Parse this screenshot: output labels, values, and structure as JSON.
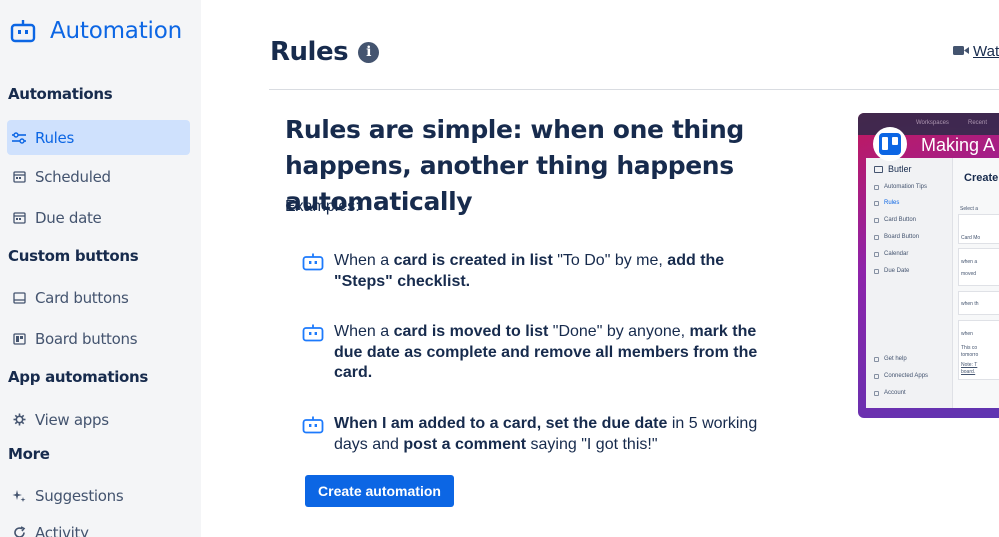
{
  "app": {
    "title": "Automation",
    "accent": "#0c66e4"
  },
  "sidebar": {
    "sections": [
      {
        "heading": "Automations"
      },
      {
        "heading": "Custom buttons"
      },
      {
        "heading": "App automations"
      },
      {
        "heading": "More"
      }
    ],
    "items": [
      {
        "label": "Rules",
        "icon": "rules-icon",
        "active": true
      },
      {
        "label": "Scheduled",
        "icon": "calendar-icon"
      },
      {
        "label": "Due date",
        "icon": "calendar-icon"
      },
      {
        "label": "Card buttons",
        "icon": "card-icon"
      },
      {
        "label": "Board buttons",
        "icon": "board-icon"
      },
      {
        "label": "View apps",
        "icon": "gear-icon"
      },
      {
        "label": "Suggestions",
        "icon": "sparkle-icon"
      },
      {
        "label": "Activity",
        "icon": "refresh-icon"
      }
    ]
  },
  "header": {
    "title": "Rules",
    "watch_label": "Wat"
  },
  "main": {
    "headline": "Rules are simple: when one thing happens, another thing happens automatically",
    "examples_label": "Examples:",
    "examples": [
      {
        "parts": [
          {
            "t": "When a ",
            "b": false
          },
          {
            "t": "card is created in list",
            "b": true
          },
          {
            "t": " \"To Do\" by me, ",
            "b": false
          },
          {
            "t": "add the \"Steps\" checklist.",
            "b": true
          }
        ]
      },
      {
        "parts": [
          {
            "t": "When a ",
            "b": false
          },
          {
            "t": "card is moved to list",
            "b": true
          },
          {
            "t": " \"Done\" by anyone, ",
            "b": false
          },
          {
            "t": "mark the due date as complete and remove all members from the card.",
            "b": true
          }
        ]
      },
      {
        "parts": [
          {
            "t": "When I am added to a card, set the due date",
            "b": true
          },
          {
            "t": " in 5 working days and ",
            "b": false
          },
          {
            "t": "post a comment",
            "b": true
          },
          {
            "t": " saying \"I got this!\"",
            "b": false
          }
        ]
      }
    ],
    "cta_label": "Create automation"
  },
  "video": {
    "title": "Making A",
    "top_bar": [
      "Workspaces",
      "Recent"
    ],
    "panel_brand": "Butler",
    "panel_items": [
      "Automation Tips",
      "Rules",
      "Card Button",
      "Board Button",
      "Calendar",
      "Due Date"
    ],
    "panel_bottom": [
      "Get help",
      "Connected Apps",
      "Account"
    ],
    "panel_heading": "Create",
    "panel_snippets": [
      "Select a",
      "Card Mo",
      "when a",
      "moved",
      "when th",
      "when",
      "This co",
      "tomorro",
      "Note: T",
      "board."
    ]
  }
}
